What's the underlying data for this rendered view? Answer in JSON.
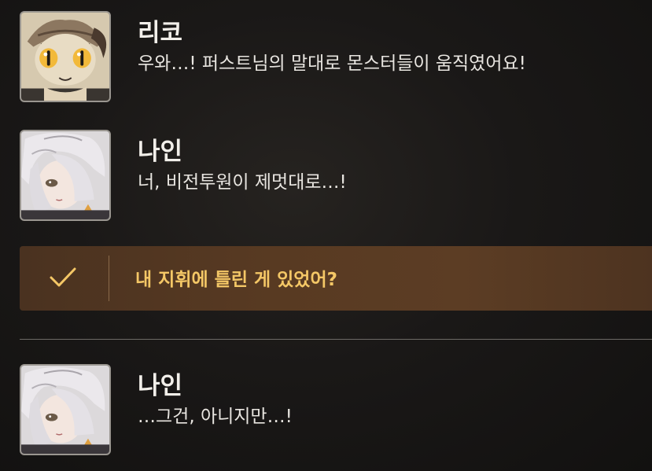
{
  "dialogue_log": [
    {
      "speaker": "리코",
      "message": "우와…! 퍼스트님의 말대로 몬스터들이 움직였어요!",
      "avatar_icon": "riko-portrait-icon"
    },
    {
      "speaker": "나인",
      "message": "너, 비전투원이 제멋대로…!",
      "avatar_icon": "nine-portrait-icon"
    }
  ],
  "selected_choice": {
    "text": "내 지휘에 틀린 게 있었어?",
    "icon": "checkmark-icon"
  },
  "dialogue_log_after": [
    {
      "speaker": "나인",
      "message": "…그건, 아니지만…!",
      "avatar_icon": "nine-portrait-icon"
    }
  ],
  "colors": {
    "choice_text": "#f4c766",
    "choice_background": "#583a22",
    "speaker_text": "#f2efea",
    "message_text": "#e8e5e0"
  }
}
